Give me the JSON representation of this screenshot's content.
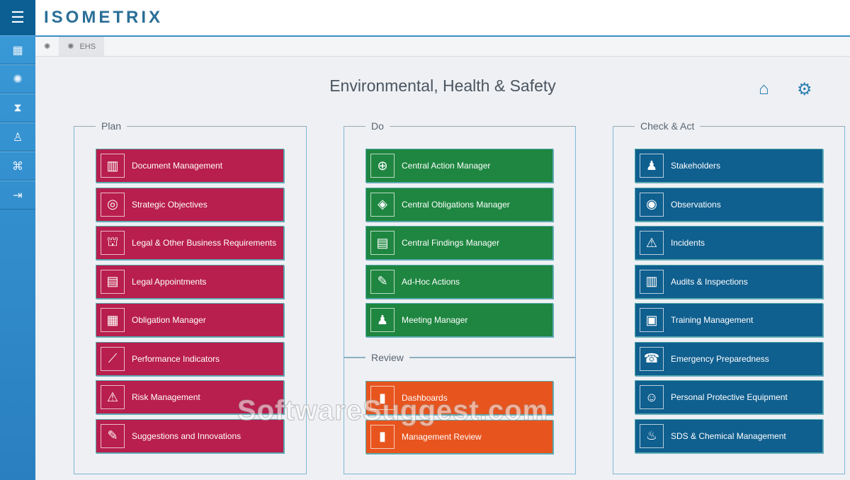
{
  "app": {
    "logo": "ISOMETRIX",
    "tab_label": "EHS",
    "title": "Environmental, Health & Safety",
    "watermark": "SoftwareSuggest.com"
  },
  "sidebar": {
    "icons": [
      "menu-icon",
      "org-chart-icon",
      "globe-icon",
      "hourglass-icon",
      "worker-icon",
      "map-icon",
      "exit-icon"
    ]
  },
  "colors": {
    "plan": "#b81e4e",
    "do": "#1e8640",
    "review": "#e8541e",
    "check": "#0f5f8f"
  },
  "panels": {
    "plan": {
      "label": "Plan",
      "items": [
        "Document Management",
        "Strategic Objectives",
        "Legal & Other Business Requirements",
        "Legal Appointments",
        "Obligation Manager",
        "Performance Indicators",
        "Risk Management",
        "Suggestions and Innovations"
      ]
    },
    "do": {
      "label": "Do",
      "items": [
        "Central Action Manager",
        "Central Obligations Manager",
        "Central Findings Manager",
        "Ad-Hoc Actions",
        "Meeting Manager"
      ]
    },
    "review": {
      "label": "Review",
      "items": [
        "Dashboards",
        "Management Review"
      ]
    },
    "check": {
      "label": "Check & Act",
      "items": [
        "Stakeholders",
        "Observations",
        "Incidents",
        "Audits & Inspections",
        "Training Management",
        "Emergency Preparedness",
        "Personal Protective Equipment",
        "SDS & Chemical Management"
      ]
    }
  }
}
